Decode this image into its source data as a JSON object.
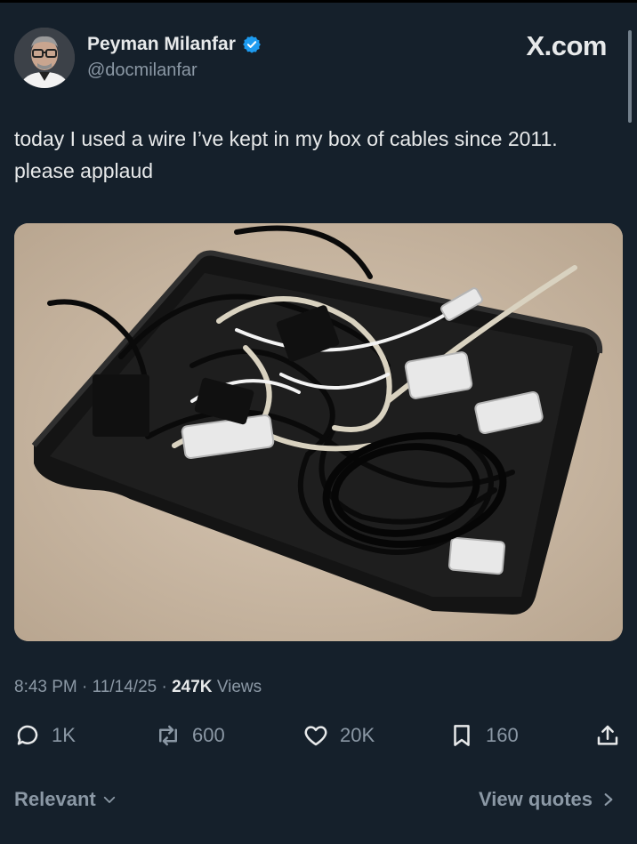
{
  "user": {
    "name": "Peyman Milanfar",
    "handle": "@docmilanfar"
  },
  "site_label": "X.com",
  "tweet": {
    "text": "today I used a wire I’ve kept in my box of cables since 2011. please applaud"
  },
  "meta": {
    "time": "8:43 PM",
    "date": "11/14/25",
    "views_count": "247K",
    "views_label": "Views",
    "separator": "·"
  },
  "actions": {
    "replies": "1K",
    "reposts": "600",
    "likes": "20K",
    "bookmarks": "160"
  },
  "footer": {
    "sort_label": "Relevant",
    "view_quotes": "View quotes"
  },
  "colors": {
    "background": "#15202b",
    "text": "#e7e9ea",
    "muted": "#8b98a5",
    "verified": "#1d9bf0"
  },
  "icons": [
    "verified-badge-icon",
    "reply-icon",
    "repost-icon",
    "like-icon",
    "bookmark-icon",
    "share-icon",
    "chevron-down-icon",
    "chevron-right-icon"
  ]
}
